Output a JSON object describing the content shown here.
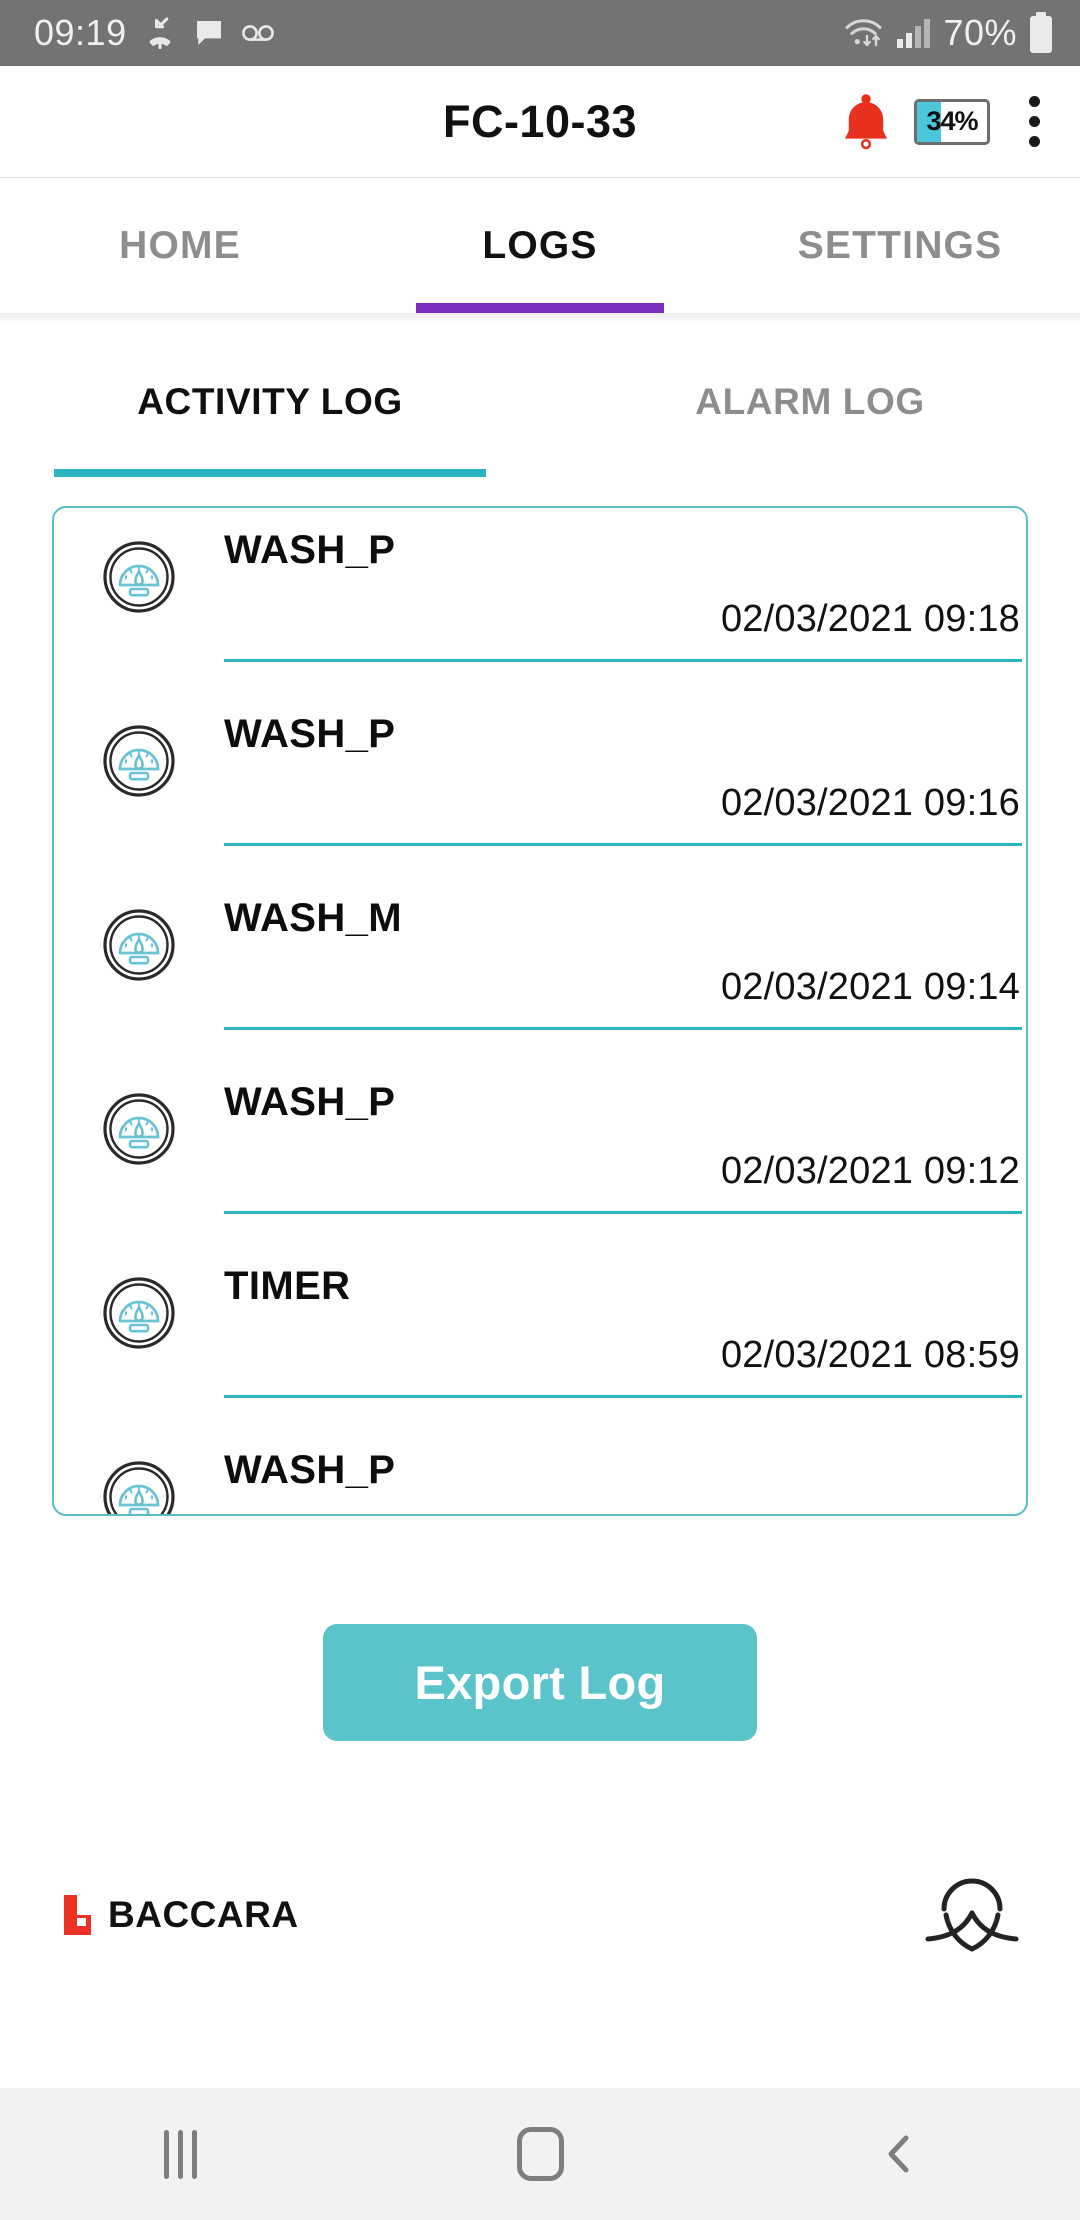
{
  "status_bar": {
    "time": "09:19",
    "icons": [
      "missed-call-icon",
      "message-icon",
      "voicemail-icon",
      "wifi-icon",
      "cellular-signal-icon"
    ],
    "battery_percent": "70%"
  },
  "app_bar": {
    "title": "FC-10-33",
    "alarm_icon": "bell-icon",
    "device_battery": "34%",
    "device_battery_level": 34,
    "overflow_icon": "kebab-menu-icon"
  },
  "main_tabs": [
    {
      "label": "HOME",
      "active": false
    },
    {
      "label": "LOGS",
      "active": true
    },
    {
      "label": "SETTINGS",
      "active": false
    }
  ],
  "sub_tabs": [
    {
      "label": "ACTIVITY LOG",
      "active": true
    },
    {
      "label": "ALARM LOG",
      "active": false
    }
  ],
  "log_entries": [
    {
      "icon": "pressure-gauge-icon",
      "label": "WASH_P",
      "timestamp": "02/03/2021 09:18"
    },
    {
      "icon": "pressure-gauge-icon",
      "label": "WASH_P",
      "timestamp": "02/03/2021 09:16"
    },
    {
      "icon": "pressure-gauge-icon",
      "label": "WASH_M",
      "timestamp": "02/03/2021 09:14"
    },
    {
      "icon": "pressure-gauge-icon",
      "label": "WASH_P",
      "timestamp": "02/03/2021 09:12"
    },
    {
      "icon": "pressure-gauge-icon",
      "label": "TIMER",
      "timestamp": "02/03/2021 08:59"
    },
    {
      "icon": "pressure-gauge-icon",
      "label": "WASH_P",
      "timestamp": ""
    }
  ],
  "actions": {
    "export_label": "Export Log"
  },
  "footer": {
    "brand_name": "BACCARA",
    "brand_mark": "baccara-b-logo",
    "partner_logo": "crossed-lines-logo"
  },
  "nav_bar": {
    "recents": "recents-icon",
    "home": "home-icon",
    "back": "back-icon"
  },
  "colors": {
    "accent_purple": "#7b2fbe",
    "accent_teal": "#2bb3c0",
    "button_teal": "#5bc4cb",
    "alarm_red": "#e8301f",
    "brand_red": "#ec3224",
    "status_bar_gray": "#737373"
  }
}
